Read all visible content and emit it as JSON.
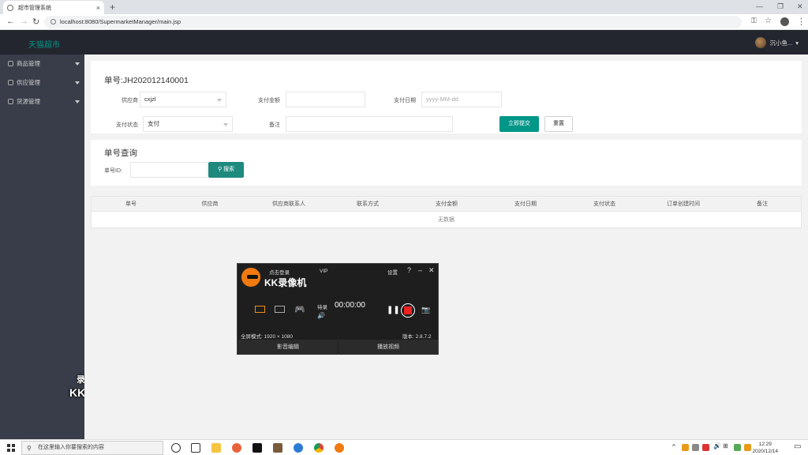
{
  "browser": {
    "tab_title": "超市管理系统",
    "url": "localhost:8080/SupermarketManager/main.jsp"
  },
  "app": {
    "logo": "天猫超市",
    "user": "沉小鱼..."
  },
  "sidebar": {
    "items": [
      {
        "label": "商品管理"
      },
      {
        "label": "供应管理"
      },
      {
        "label": "货源管理"
      }
    ]
  },
  "form": {
    "order_no": "单号:JH202012140001",
    "supplier_label": "供应商",
    "supplier_value": "cxjzl",
    "amount_label": "支付金额",
    "amount_value": "",
    "date_label": "支付日期",
    "date_placeholder": "yyyy-MM-dd",
    "status_label": "支付状态",
    "status_value": "支付",
    "remark_label": "备注",
    "remark_value": "",
    "submit": "立即提交",
    "reset": "重置"
  },
  "query": {
    "legend": "单号查询",
    "id_label": "单号ID:",
    "id_value": "",
    "search": "搜索"
  },
  "table": {
    "headers": [
      "单号",
      "供应商",
      "供应商联系人",
      "联系方式",
      "支付金额",
      "支付日期",
      "支付状态",
      "订单创建时间",
      "备注"
    ],
    "empty": "无数据"
  },
  "recorder": {
    "title": "KK录像机",
    "login": "点击登录",
    "vip": "VIP",
    "settings": "设置",
    "timer": "00:00:00",
    "mode_label": "全屏模式: 1920 × 1080",
    "version": "版本: 2.8.7.2",
    "btn_left": "影音编辑",
    "btn_right": "播放视频",
    "status": "待录"
  },
  "watermark": {
    "line1": "录制工具",
    "line2": "KK录像机"
  },
  "taskbar": {
    "search_placeholder": "在这里输入你要搜索的内容",
    "time": "12:29",
    "date": "2020/12/14"
  }
}
